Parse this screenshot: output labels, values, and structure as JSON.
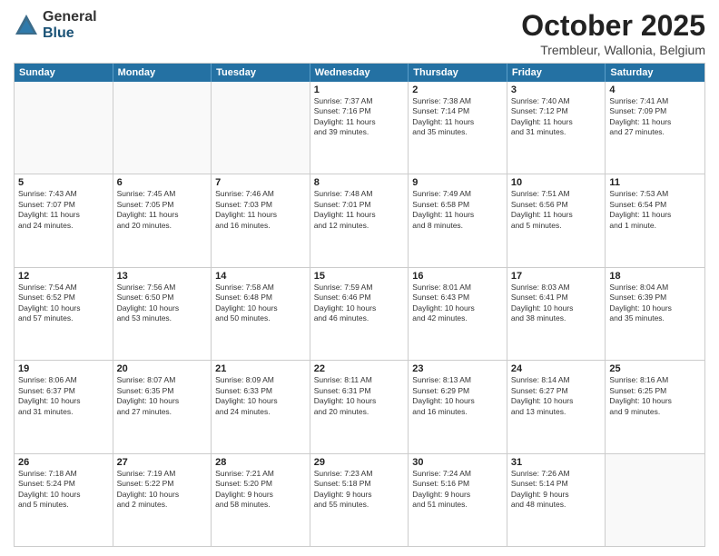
{
  "header": {
    "logo": {
      "general": "General",
      "blue": "Blue"
    },
    "title": "October 2025",
    "location": "Trembleur, Wallonia, Belgium"
  },
  "weekdays": [
    "Sunday",
    "Monday",
    "Tuesday",
    "Wednesday",
    "Thursday",
    "Friday",
    "Saturday"
  ],
  "rows": [
    [
      {
        "day": "",
        "empty": true
      },
      {
        "day": "",
        "empty": true
      },
      {
        "day": "",
        "empty": true
      },
      {
        "day": "1",
        "lines": [
          "Sunrise: 7:37 AM",
          "Sunset: 7:16 PM",
          "Daylight: 11 hours",
          "and 39 minutes."
        ]
      },
      {
        "day": "2",
        "lines": [
          "Sunrise: 7:38 AM",
          "Sunset: 7:14 PM",
          "Daylight: 11 hours",
          "and 35 minutes."
        ]
      },
      {
        "day": "3",
        "lines": [
          "Sunrise: 7:40 AM",
          "Sunset: 7:12 PM",
          "Daylight: 11 hours",
          "and 31 minutes."
        ]
      },
      {
        "day": "4",
        "lines": [
          "Sunrise: 7:41 AM",
          "Sunset: 7:09 PM",
          "Daylight: 11 hours",
          "and 27 minutes."
        ]
      }
    ],
    [
      {
        "day": "5",
        "lines": [
          "Sunrise: 7:43 AM",
          "Sunset: 7:07 PM",
          "Daylight: 11 hours",
          "and 24 minutes."
        ]
      },
      {
        "day": "6",
        "lines": [
          "Sunrise: 7:45 AM",
          "Sunset: 7:05 PM",
          "Daylight: 11 hours",
          "and 20 minutes."
        ]
      },
      {
        "day": "7",
        "lines": [
          "Sunrise: 7:46 AM",
          "Sunset: 7:03 PM",
          "Daylight: 11 hours",
          "and 16 minutes."
        ]
      },
      {
        "day": "8",
        "lines": [
          "Sunrise: 7:48 AM",
          "Sunset: 7:01 PM",
          "Daylight: 11 hours",
          "and 12 minutes."
        ]
      },
      {
        "day": "9",
        "lines": [
          "Sunrise: 7:49 AM",
          "Sunset: 6:58 PM",
          "Daylight: 11 hours",
          "and 8 minutes."
        ]
      },
      {
        "day": "10",
        "lines": [
          "Sunrise: 7:51 AM",
          "Sunset: 6:56 PM",
          "Daylight: 11 hours",
          "and 5 minutes."
        ]
      },
      {
        "day": "11",
        "lines": [
          "Sunrise: 7:53 AM",
          "Sunset: 6:54 PM",
          "Daylight: 11 hours",
          "and 1 minute."
        ]
      }
    ],
    [
      {
        "day": "12",
        "lines": [
          "Sunrise: 7:54 AM",
          "Sunset: 6:52 PM",
          "Daylight: 10 hours",
          "and 57 minutes."
        ]
      },
      {
        "day": "13",
        "lines": [
          "Sunrise: 7:56 AM",
          "Sunset: 6:50 PM",
          "Daylight: 10 hours",
          "and 53 minutes."
        ]
      },
      {
        "day": "14",
        "lines": [
          "Sunrise: 7:58 AM",
          "Sunset: 6:48 PM",
          "Daylight: 10 hours",
          "and 50 minutes."
        ]
      },
      {
        "day": "15",
        "lines": [
          "Sunrise: 7:59 AM",
          "Sunset: 6:46 PM",
          "Daylight: 10 hours",
          "and 46 minutes."
        ]
      },
      {
        "day": "16",
        "lines": [
          "Sunrise: 8:01 AM",
          "Sunset: 6:43 PM",
          "Daylight: 10 hours",
          "and 42 minutes."
        ]
      },
      {
        "day": "17",
        "lines": [
          "Sunrise: 8:03 AM",
          "Sunset: 6:41 PM",
          "Daylight: 10 hours",
          "and 38 minutes."
        ]
      },
      {
        "day": "18",
        "lines": [
          "Sunrise: 8:04 AM",
          "Sunset: 6:39 PM",
          "Daylight: 10 hours",
          "and 35 minutes."
        ]
      }
    ],
    [
      {
        "day": "19",
        "lines": [
          "Sunrise: 8:06 AM",
          "Sunset: 6:37 PM",
          "Daylight: 10 hours",
          "and 31 minutes."
        ]
      },
      {
        "day": "20",
        "lines": [
          "Sunrise: 8:07 AM",
          "Sunset: 6:35 PM",
          "Daylight: 10 hours",
          "and 27 minutes."
        ]
      },
      {
        "day": "21",
        "lines": [
          "Sunrise: 8:09 AM",
          "Sunset: 6:33 PM",
          "Daylight: 10 hours",
          "and 24 minutes."
        ]
      },
      {
        "day": "22",
        "lines": [
          "Sunrise: 8:11 AM",
          "Sunset: 6:31 PM",
          "Daylight: 10 hours",
          "and 20 minutes."
        ]
      },
      {
        "day": "23",
        "lines": [
          "Sunrise: 8:13 AM",
          "Sunset: 6:29 PM",
          "Daylight: 10 hours",
          "and 16 minutes."
        ]
      },
      {
        "day": "24",
        "lines": [
          "Sunrise: 8:14 AM",
          "Sunset: 6:27 PM",
          "Daylight: 10 hours",
          "and 13 minutes."
        ]
      },
      {
        "day": "25",
        "lines": [
          "Sunrise: 8:16 AM",
          "Sunset: 6:25 PM",
          "Daylight: 10 hours",
          "and 9 minutes."
        ]
      }
    ],
    [
      {
        "day": "26",
        "lines": [
          "Sunrise: 7:18 AM",
          "Sunset: 5:24 PM",
          "Daylight: 10 hours",
          "and 5 minutes."
        ]
      },
      {
        "day": "27",
        "lines": [
          "Sunrise: 7:19 AM",
          "Sunset: 5:22 PM",
          "Daylight: 10 hours",
          "and 2 minutes."
        ]
      },
      {
        "day": "28",
        "lines": [
          "Sunrise: 7:21 AM",
          "Sunset: 5:20 PM",
          "Daylight: 9 hours",
          "and 58 minutes."
        ]
      },
      {
        "day": "29",
        "lines": [
          "Sunrise: 7:23 AM",
          "Sunset: 5:18 PM",
          "Daylight: 9 hours",
          "and 55 minutes."
        ]
      },
      {
        "day": "30",
        "lines": [
          "Sunrise: 7:24 AM",
          "Sunset: 5:16 PM",
          "Daylight: 9 hours",
          "and 51 minutes."
        ]
      },
      {
        "day": "31",
        "lines": [
          "Sunrise: 7:26 AM",
          "Sunset: 5:14 PM",
          "Daylight: 9 hours",
          "and 48 minutes."
        ]
      },
      {
        "day": "",
        "empty": true
      }
    ]
  ]
}
